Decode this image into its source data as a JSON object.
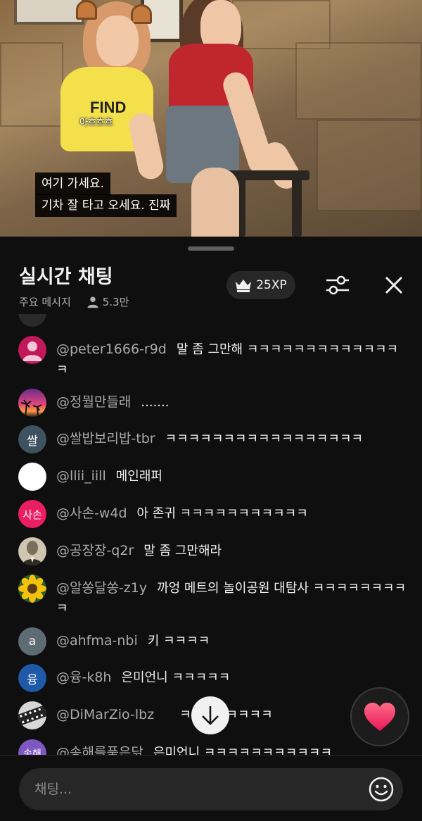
{
  "video": {
    "small_caption": "아흐흐흐",
    "subtitles": [
      "여기 가세요.",
      "기차 잘 타고 오세요. 진짜"
    ]
  },
  "panel": {
    "title": "실시간 채팅",
    "mode_label": "주요 메시지",
    "viewer_count": "5.3만",
    "xp_label": "25XP",
    "icons": {
      "crown": "crown-icon",
      "filter": "tune-sliders-icon",
      "close": "close-icon",
      "scroll_down": "arrow-down-icon",
      "heart": "heart-reaction-icon",
      "emoji": "smiley-icon",
      "viewers": "person-icon"
    }
  },
  "messages": [
    {
      "author": "@peter1666-r9d",
      "text": "말 좀 그만해 ㅋㅋㅋㅋㅋㅋㅋㅋㅋㅋㅋㅋㅋㅋ",
      "avatar_text": "",
      "avatar_color": "#c2185b"
    },
    {
      "author": "@정뭘만들래",
      "text": ".......",
      "avatar_text": "",
      "avatar_color": "#7b3fa0"
    },
    {
      "author": "@쌀밥보리밥-tbr",
      "text": "ㅋㅋㅋㅋㅋㅋㅋㅋㅋㅋㅋㅋㅋㅋㅋㅋㅋ",
      "avatar_text": "쌀",
      "avatar_color": "#3e5360"
    },
    {
      "author": "@llii_iill",
      "text": "메인래퍼",
      "avatar_text": "",
      "avatar_color": "#ffffff"
    },
    {
      "author": "@사손-w4d",
      "text": "아 존귀 ㅋㅋㅋㅋㅋㅋㅋㅋㅋㅋㅋ",
      "avatar_text": "사손",
      "avatar_color": "#e91e63"
    },
    {
      "author": "@공장장-q2r",
      "text": "말 좀 그만해라",
      "avatar_text": "",
      "avatar_color": "#8d8270"
    },
    {
      "author": "@알쏭달쏭-z1y",
      "text": "까엉 메트의 놀이공원 대탐사 ㅋㅋㅋㅋㅋㅋㅋㅋㅋ",
      "avatar_text": "",
      "avatar_color": "#2e5d2a"
    },
    {
      "author": "@ahfma-nbi",
      "text": "키 ㅋㅋㅋㅋ",
      "avatar_text": "a",
      "avatar_color": "#5f6b73"
    },
    {
      "author": "@융-k8h",
      "text": "은미언니 ㅋㅋㅋㅋㅋ",
      "avatar_text": "융",
      "avatar_color": "#1e5aa8"
    },
    {
      "author": "@DiMarZio-lbz",
      "text": "ㅋㅋㅋㅋㅋㅋㅋㅋ",
      "avatar_text": "",
      "avatar_color": "#9e9e9e"
    },
    {
      "author": "@송해를품은닭",
      "text": "은미언니 ㅋㅋㅋㅋㅋㅋㅋㅋㅋㅋㅋ",
      "avatar_text": "송해",
      "avatar_color": "#7e57c2"
    }
  ],
  "floating_emoji": "😄",
  "input": {
    "placeholder": "채팅..."
  }
}
